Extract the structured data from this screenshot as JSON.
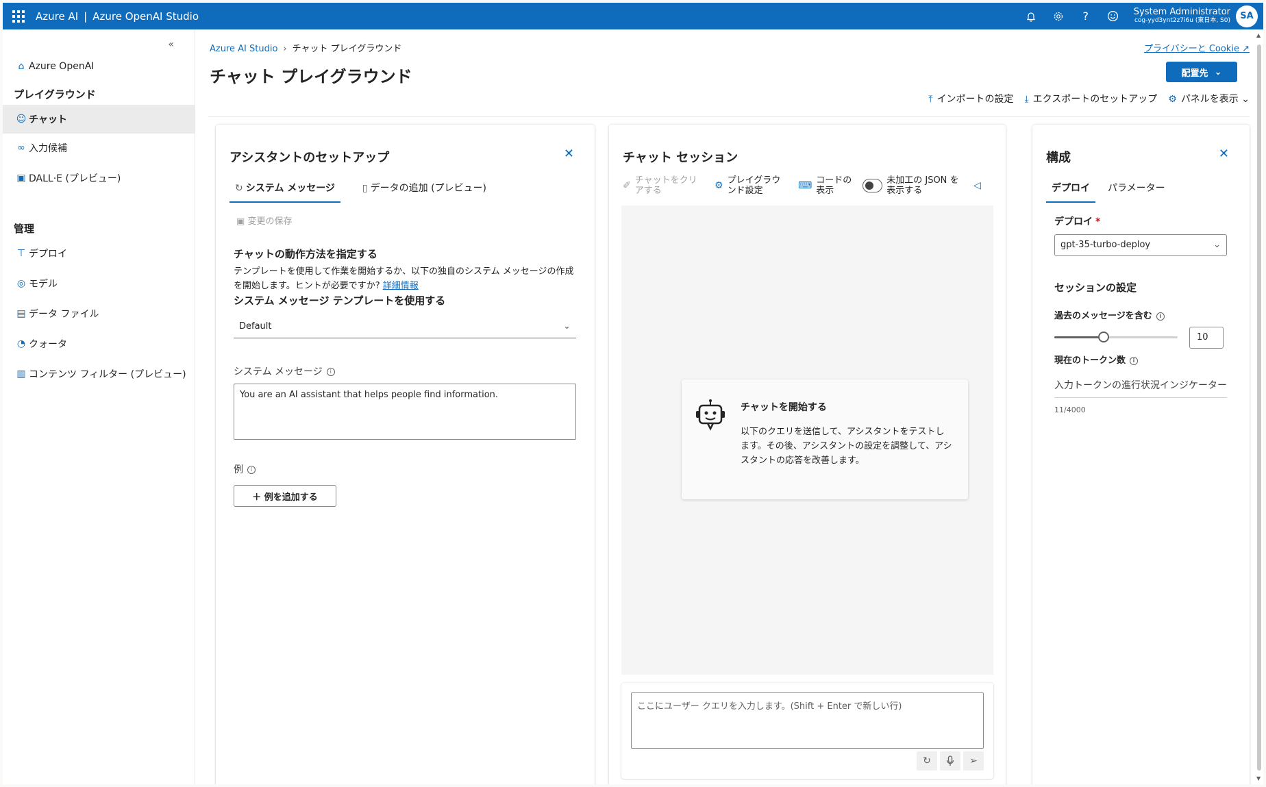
{
  "topbar": {
    "brand": "Azure AI",
    "separator": "|",
    "product": "Azure OpenAI Studio",
    "user_name": "System Administrator",
    "user_tenant": "cog-yyd3ynt2z7i6u (東日本, S0)",
    "avatar_initials": "SA",
    "bg_color": "#0f6cbd"
  },
  "sidebar": {
    "collapse": "«",
    "items": [
      {
        "label": "Azure OpenAI",
        "icon": "home-icon"
      },
      {
        "label": "プレイグラウンド",
        "heading": true
      },
      {
        "label": "チャット",
        "icon": "chat-icon",
        "active": true
      },
      {
        "label": "入力候補",
        "icon": "completions-icon"
      },
      {
        "label": "DALL·E (プレビュー)",
        "icon": "image-icon"
      },
      {
        "label": "管理",
        "heading": true
      },
      {
        "label": "デプロイ",
        "icon": "deploy-icon"
      },
      {
        "label": "モデル",
        "icon": "model-icon"
      },
      {
        "label": "データ ファイル",
        "icon": "data-file-icon"
      },
      {
        "label": "クォータ",
        "icon": "quota-icon"
      },
      {
        "label": "コンテンツ フィルター (プレビュー)",
        "icon": "content-filter-icon"
      }
    ]
  },
  "header": {
    "breadcrumb_root": "Azure AI Studio",
    "breadcrumb_current": "チャット プレイグラウンド",
    "title": "チャット プレイグラウンド",
    "privacy_link": "プライバシーと Cookie",
    "deploy_button": "配置先",
    "import_settings": "インポートの設定",
    "export_setup": "エクスポートのセットアップ",
    "show_panels": "パネルを表示"
  },
  "assistant_setup": {
    "title": "アシスタントのセットアップ",
    "tab_system": "システム メッセージ",
    "tab_data": "データの追加 (プレビュー)",
    "save_changes": "変更の保存",
    "behavior_heading": "チャットの動作方法を指定する",
    "description": "テンプレートを使用して作業を開始するか、以下の独自のシステム メッセージの作成を開始します。ヒントが必要ですか?",
    "learn_more": "詳細情報",
    "template_heading": "システム メッセージ テンプレートを使用する",
    "template_value": "Default",
    "system_message_label": "システム メッセージ",
    "system_message_value": "You are an AI assistant that helps people find information.",
    "examples_label": "例",
    "add_example": "例を追加する"
  },
  "chat_session": {
    "title": "チャット セッション",
    "clear_chat": "チャットをクリアする",
    "playground_settings": "プレイグラウンド設定",
    "view_code": "コードの表示",
    "show_raw_json": "未加工の JSON を表示する",
    "start_title": "チャットを開始する",
    "start_desc": "以下のクエリを送信して、アシスタントをテストします。その後、アシスタントの設定を調整して、アシスタントの応答を改善します。",
    "input_placeholder": "ここにユーザー クエリを入力します。(Shift + Enter で新しい行)"
  },
  "configuration": {
    "title": "構成",
    "tab_deploy": "デプロイ",
    "tab_params": "パラメーター",
    "deploy_label": "デプロイ",
    "required_mark": "*",
    "deploy_value": "gpt-35-turbo-deploy",
    "session_settings": "セッションの設定",
    "past_messages_label": "過去のメッセージを含む",
    "past_messages_value": "10",
    "past_messages_fraction": 0.4,
    "current_tokens_label": "現在のトークン数",
    "token_indicator": "入力トークンの進行状況インジケーター",
    "token_count": "11/4000"
  }
}
